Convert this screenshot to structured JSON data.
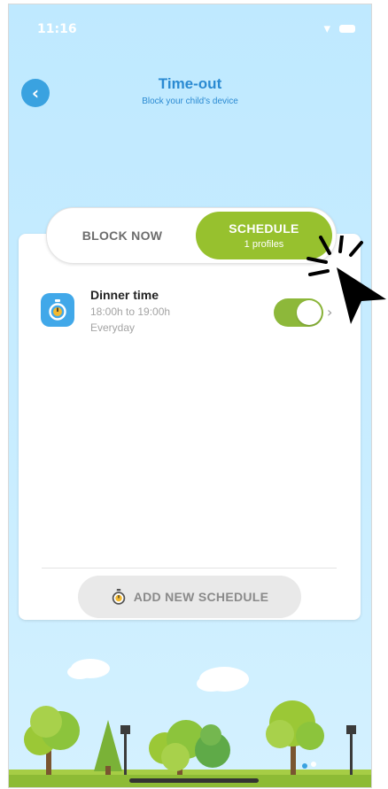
{
  "status_bar": {
    "time": "11:16"
  },
  "header": {
    "title": "Time-out",
    "subtitle": "Block your child's device"
  },
  "tabs": {
    "block_now": "BLOCK NOW",
    "schedule": "SCHEDULE",
    "schedule_sub": "1 profiles"
  },
  "schedules": [
    {
      "name": "Dinner time",
      "hours": "18:00h to 19:00h",
      "days": "Everyday",
      "enabled": true
    }
  ],
  "add_button": {
    "label": "ADD NEW SCHEDULE"
  },
  "icons": [
    "back-arrow-icon",
    "wifi-icon",
    "battery-icon",
    "stopwatch-icon",
    "chevron-right-icon",
    "cursor-pointer-icon"
  ],
  "colors": {
    "accent_green": "#97c12e",
    "accent_blue": "#2a8ad2",
    "sky": "#c9edff"
  }
}
